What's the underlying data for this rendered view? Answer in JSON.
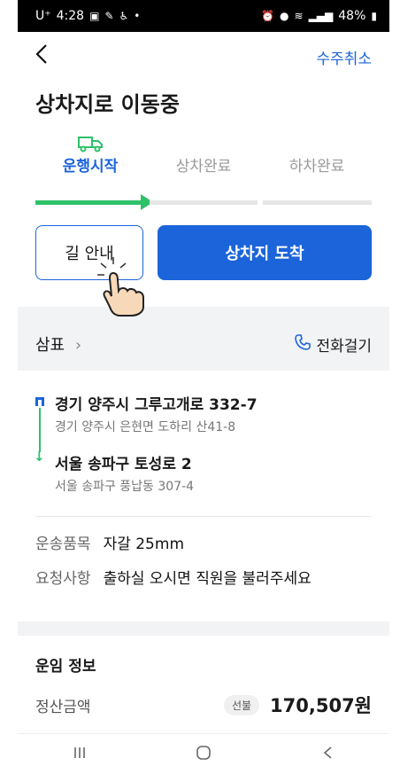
{
  "status_bar": {
    "carrier": "U⁺",
    "time": "4:28",
    "battery": "48%"
  },
  "header": {
    "back_icon": "chevron-left-icon",
    "cancel_label": "수주취소"
  },
  "title": "상차지로 이동중",
  "steps": [
    {
      "label": "운행시작",
      "active": true
    },
    {
      "label": "상차완료",
      "active": false
    },
    {
      "label": "하차완료",
      "active": false
    }
  ],
  "buttons": {
    "guide": "길 안내",
    "arrive": "상차지 도착"
  },
  "shipper": {
    "name": "삼표",
    "chevron": "›",
    "call_label": "전화걸기"
  },
  "route": {
    "origin": {
      "road": "경기 양주시 그루고개로 332-7",
      "jibun": "경기 양주시 은현면 도하리 산41-8"
    },
    "destination": {
      "road": "서울 송파구 토성로 2",
      "jibun": "서울 송파구 풍납동 307-4"
    }
  },
  "goods": {
    "item_key": "운송품목",
    "item_value": "자갈 25mm",
    "request_key": "요청사항",
    "request_value": "출하실 오시면 직원을 불러주세요"
  },
  "fare": {
    "title": "운임 정보",
    "amount_key": "정산금액",
    "badge": "선불",
    "amount": "170,507원"
  },
  "colors": {
    "accent": "#1b64da",
    "progress": "#2ec168"
  }
}
